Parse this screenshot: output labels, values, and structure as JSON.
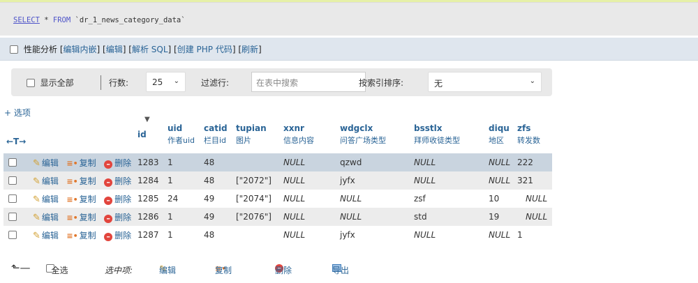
{
  "sql": {
    "select": "SELECT",
    "star": " * ",
    "from": "FROM",
    "table": " `dr_1_news_category_data`"
  },
  "profiling": {
    "label": "性能分析",
    "links": [
      "编辑内嵌",
      "编辑",
      "解析 SQL",
      "创建 PHP 代码",
      "刷新"
    ]
  },
  "nav": {
    "show_all": "显示全部",
    "rows_label": "行数:",
    "rows_value": "25",
    "filter_label": "过滤行:",
    "filter_placeholder": "在表中搜索",
    "sort_label": "按索引排序:",
    "sort_value": "无"
  },
  "options_link": "+ 选项",
  "table": {
    "arrows": "←T→",
    "columns": [
      {
        "name": "id",
        "comment": ""
      },
      {
        "name": "uid",
        "comment": "作者uid"
      },
      {
        "name": "catid",
        "comment": "栏目id"
      },
      {
        "name": "tupian",
        "comment": "图片"
      },
      {
        "name": "xxnr",
        "comment": "信息内容"
      },
      {
        "name": "wdgclx",
        "comment": "问答广场类型"
      },
      {
        "name": "bsstlx",
        "comment": "拜师收徒类型"
      },
      {
        "name": "diqu",
        "comment": "地区"
      },
      {
        "name": "zfs",
        "comment": "转发数"
      }
    ],
    "actions": {
      "edit": "编辑",
      "copy": "复制",
      "delete": "删除"
    },
    "rows": [
      {
        "id": "1283",
        "uid": "1",
        "catid": "48",
        "tupian": "",
        "xxnr": "NULL",
        "wdgclx": "qzwd",
        "bsstlx": "NULL",
        "diqu": "NULL",
        "zfs": "222"
      },
      {
        "id": "1284",
        "uid": "1",
        "catid": "48",
        "tupian": "[\"2072\"]",
        "xxnr": "NULL",
        "wdgclx": "jyfx",
        "bsstlx": "NULL",
        "diqu": "NULL",
        "zfs": "321"
      },
      {
        "id": "1285",
        "uid": "24",
        "catid": "49",
        "tupian": "[\"2074\"]",
        "xxnr": "NULL",
        "wdgclx": "NULL",
        "bsstlx": "zsf",
        "diqu": "10",
        "zfs": "NULL"
      },
      {
        "id": "1286",
        "uid": "1",
        "catid": "49",
        "tupian": "[\"2076\"]",
        "xxnr": "NULL",
        "wdgclx": "NULL",
        "bsstlx": "std",
        "diqu": "19",
        "zfs": "NULL"
      },
      {
        "id": "1287",
        "uid": "1",
        "catid": "48",
        "tupian": "",
        "xxnr": "NULL",
        "wdgclx": "jyfx",
        "bsstlx": "NULL",
        "diqu": "NULL",
        "zfs": "1"
      }
    ]
  },
  "footer": {
    "select_all": "全选",
    "selected_label": "选中项:",
    "edit": "编辑",
    "copy": "复制",
    "delete": "删除",
    "export": "导出"
  },
  "colors": {
    "link": "#2a6496",
    "highlight_row": "#c9d4df",
    "sql_box": "#e9e9e9"
  }
}
